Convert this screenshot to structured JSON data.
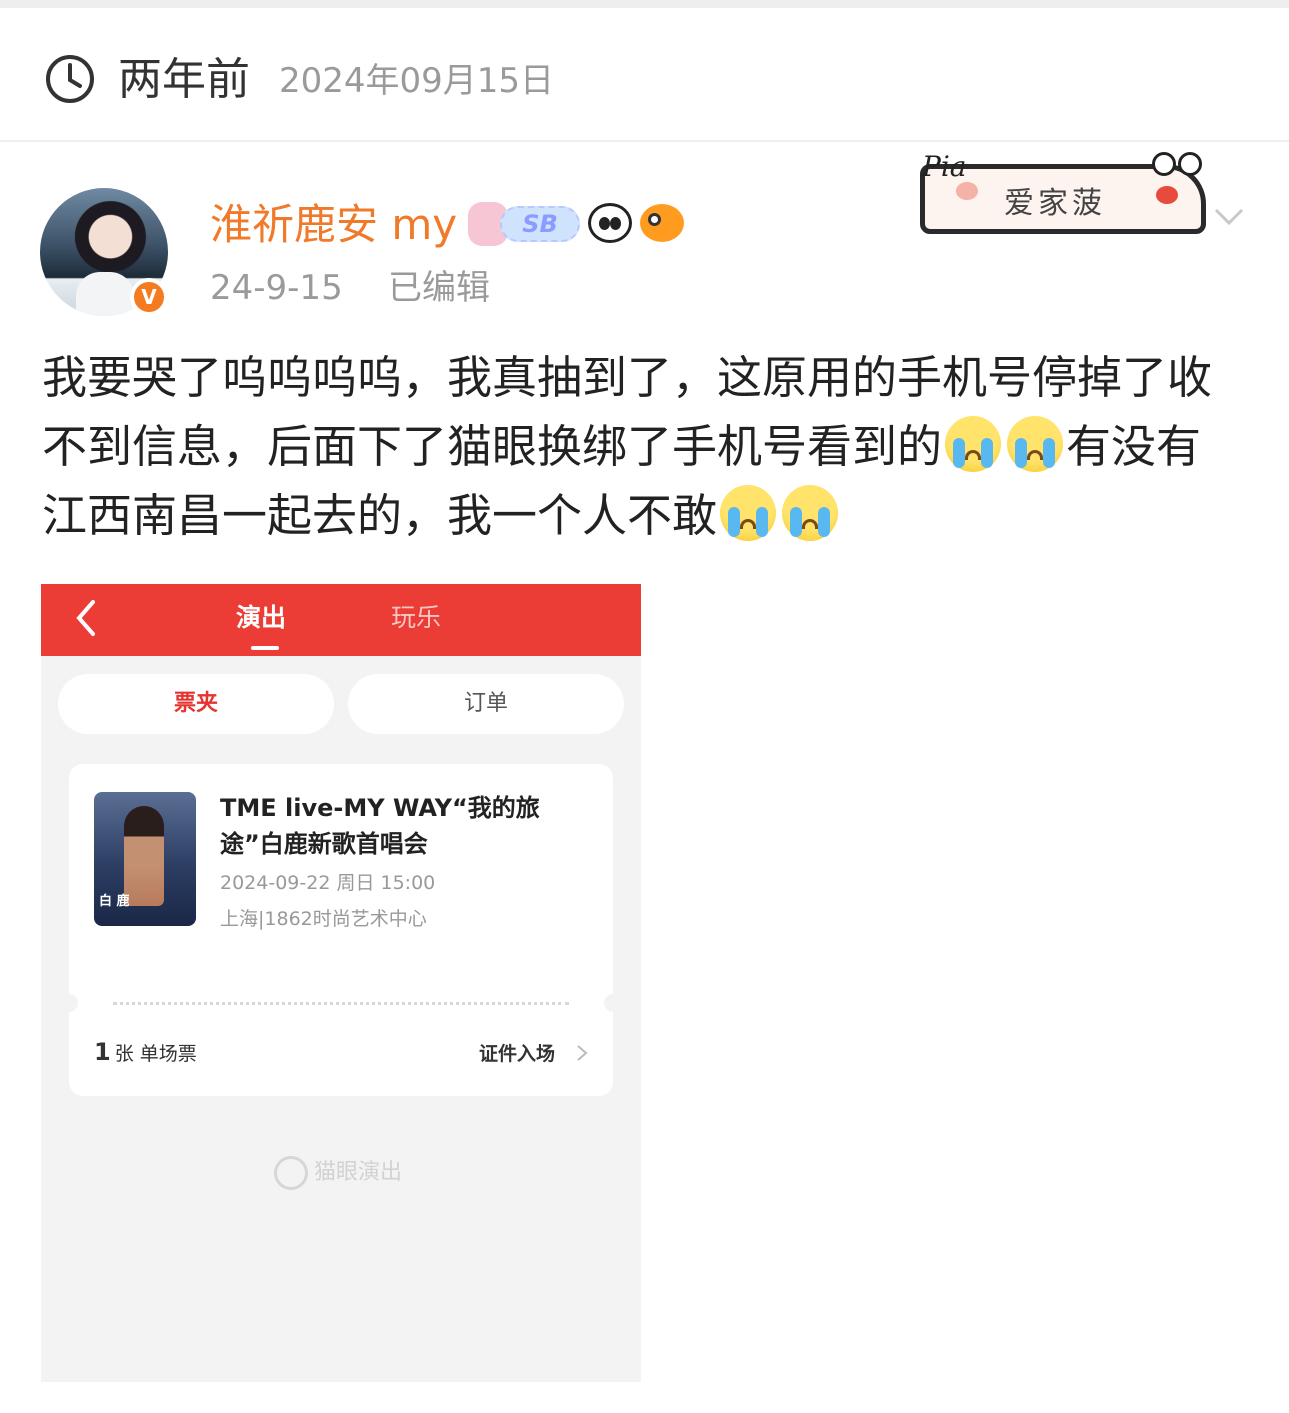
{
  "timebar": {
    "relative": "两年前",
    "absolute": "2024年09月15日",
    "icon": "clock-icon"
  },
  "post": {
    "author": {
      "name": "淮祈鹿安 my",
      "verified_badge": "V",
      "name_color": "#f07a2a"
    },
    "badges": {
      "sb": "SB",
      "emoji_1": "panda-icon",
      "emoji_2": "pufferfish-icon"
    },
    "decoration": {
      "pia": "Pia",
      "label": "爱家菠"
    },
    "meta": {
      "time": "24-9-15",
      "edited": "已编辑"
    },
    "text": {
      "part1": "我要哭了呜呜呜呜，我真抽到了，这原用的手机号停掉了收不到信息，后面下了猫眼换绑了手机号看到的",
      "part2": "有没有江西南昌一起去的，我一个人不敢",
      "emoji": "loudly-crying-face-icon"
    }
  },
  "screenshot": {
    "header": {
      "tab_active": "演出",
      "tab_inactive": "玩乐",
      "color": "#eb3d36"
    },
    "pills": {
      "tickets": "票夹",
      "orders": "订单"
    },
    "ticket": {
      "title": "TME live-MY WAY“我的旅途”白鹿新歌首唱会",
      "poster_name": "白 鹿",
      "datetime": "2024-09-22 周日 15:00",
      "venue": "上海|1862时尚艺术中心",
      "qty_num": "1",
      "qty_label": "张 单场票",
      "entry": "证件入场"
    },
    "watermark": "猫眼演出"
  }
}
